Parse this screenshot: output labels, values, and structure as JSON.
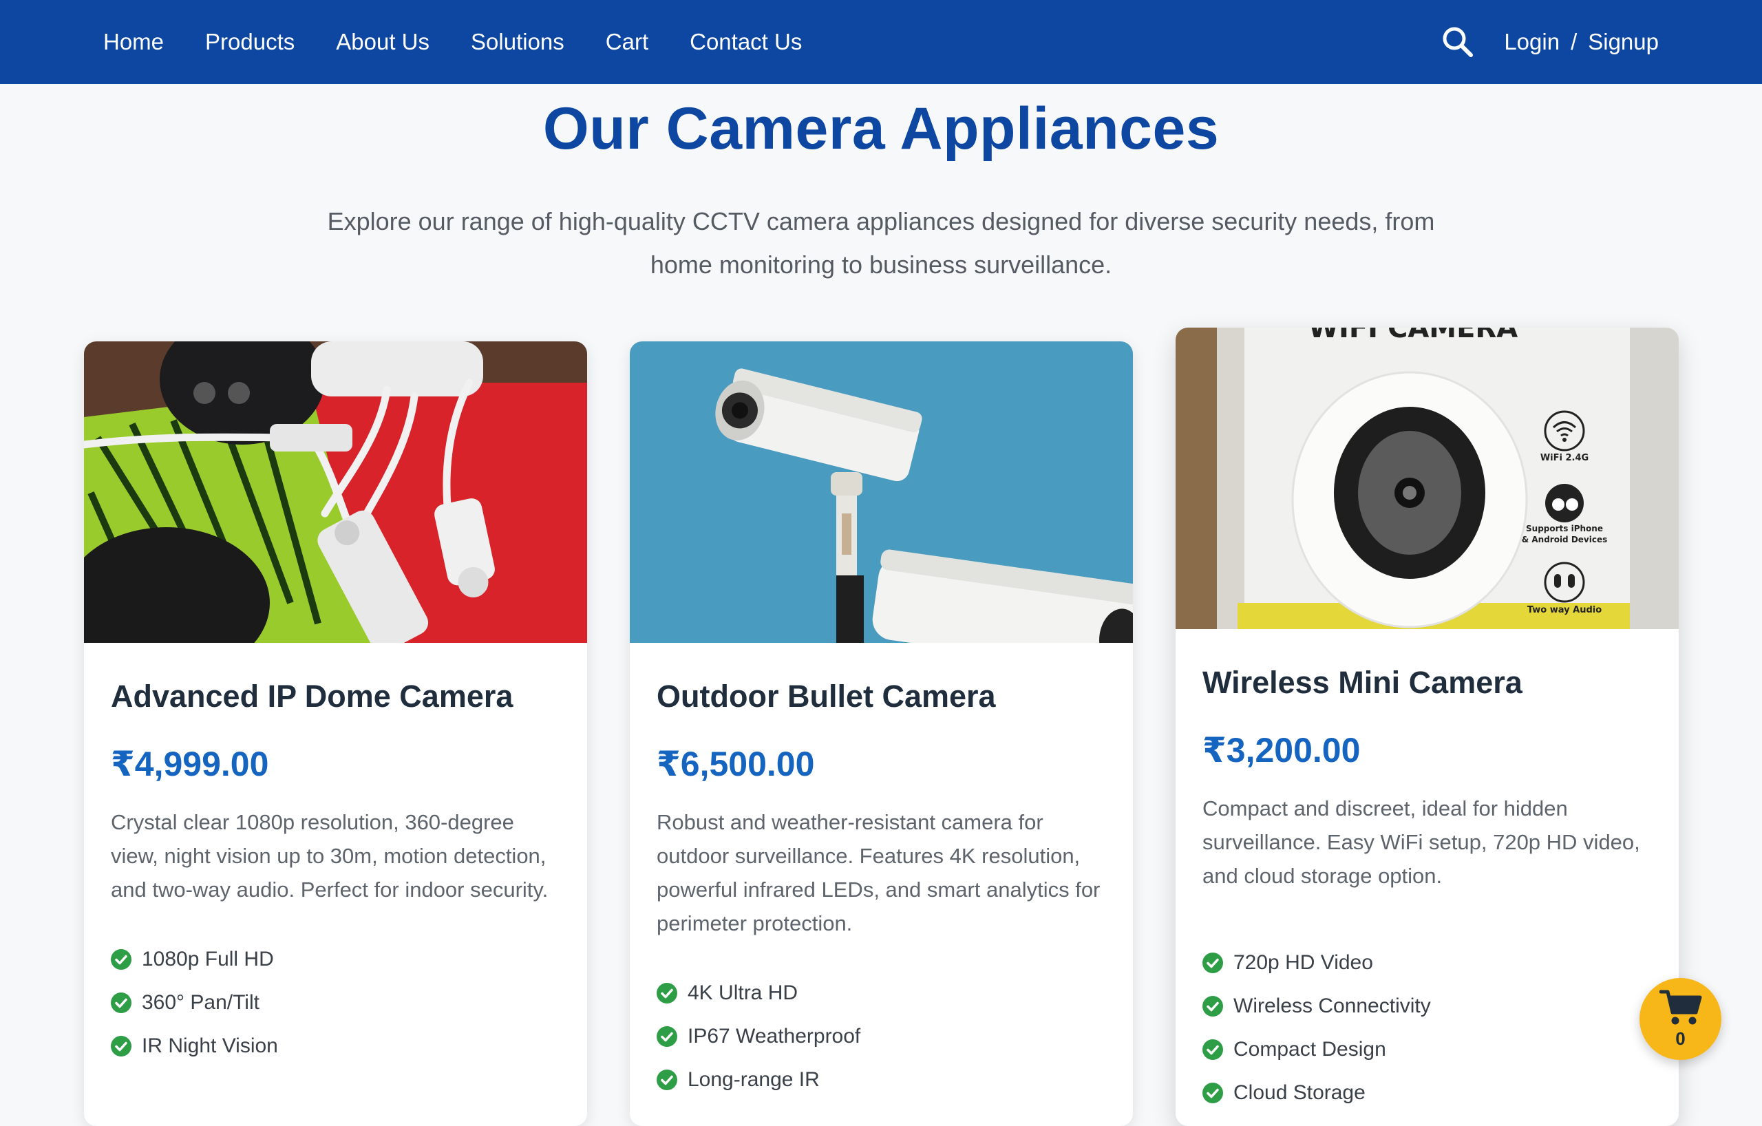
{
  "nav": {
    "links": [
      "Home",
      "Products",
      "About Us",
      "Solutions",
      "Cart",
      "Contact Us"
    ],
    "login": "Login",
    "separator": "/",
    "signup": "Signup",
    "search_icon": "search-icon"
  },
  "page": {
    "title": "Our Camera Appliances",
    "subtitle": "Explore our range of high-quality CCTV camera appliances designed for diverse security needs, from home monitoring to business surveillance."
  },
  "products": [
    {
      "name": "Advanced IP Dome Camera",
      "price": "₹4,999.00",
      "description": "Crystal clear 1080p resolution, 360-degree view, night vision up to 30m, motion detection, and two-way audio. Perfect for indoor security.",
      "features": [
        "1080p Full HD",
        "360° Pan/Tilt",
        "IR Night Vision"
      ]
    },
    {
      "name": "Outdoor Bullet Camera",
      "price": "₹6,500.00",
      "description": "Robust and weather-resistant camera for outdoor surveillance. Features 4K resolution, powerful infrared LEDs, and smart analytics for perimeter protection.",
      "features": [
        "4K Ultra HD",
        "IP67 Weatherproof",
        "Long-range IR"
      ]
    },
    {
      "name": "Wireless Mini Camera",
      "price": "₹3,200.00",
      "description": "Compact and discreet, ideal for hidden surveillance. Easy WiFi setup, 720p HD video, and cloud storage option.",
      "features": [
        "720p HD Video",
        "Wireless Connectivity",
        "Compact Design",
        "Cloud Storage"
      ],
      "box_label": "WIFI CAMERA",
      "box_badges": [
        "WiFi 2.4G",
        "Supports iPhone",
        "& Android Devices",
        "Two way Audio"
      ]
    }
  ],
  "cart": {
    "count": "0",
    "icon": "cart-icon"
  },
  "colors": {
    "nav_bg": "#0d47a1",
    "title": "#0d47a1",
    "price": "#1565c0",
    "check": "#2e9e46",
    "cart_fab": "#f8b718"
  }
}
